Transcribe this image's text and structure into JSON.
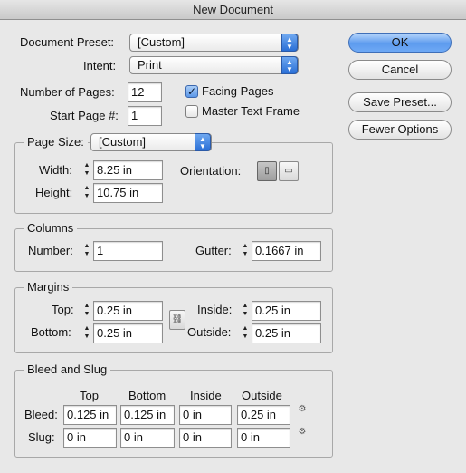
{
  "window": {
    "title": "New Document"
  },
  "document_preset": {
    "label": "Document Preset:",
    "value": "[Custom]"
  },
  "intent": {
    "label": "Intent:",
    "value": "Print"
  },
  "pages": {
    "number_label": "Number of Pages:",
    "number_value": "12",
    "start_label": "Start Page #:",
    "start_value": "1"
  },
  "options": {
    "facing_pages_label": "Facing Pages",
    "facing_pages_checked": true,
    "master_text_frame_label": "Master Text Frame",
    "master_text_frame_checked": false
  },
  "buttons": {
    "ok": "OK",
    "cancel": "Cancel",
    "save_preset": "Save Preset...",
    "fewer_options": "Fewer Options"
  },
  "page_size": {
    "label": "Page Size:",
    "value": "[Custom]",
    "width_label": "Width:",
    "width_value": "8.25 in",
    "height_label": "Height:",
    "height_value": "10.75 in",
    "orientation_label": "Orientation:",
    "orientation_selected": "portrait"
  },
  "columns": {
    "title": "Columns",
    "number_label": "Number:",
    "number_value": "1",
    "gutter_label": "Gutter:",
    "gutter_value": "0.1667 in"
  },
  "margins": {
    "title": "Margins",
    "top_label": "Top:",
    "top_value": "0.25 in",
    "bottom_label": "Bottom:",
    "bottom_value": "0.25 in",
    "inside_label": "Inside:",
    "inside_value": "0.25 in",
    "outside_label": "Outside:",
    "outside_value": "0.25 in"
  },
  "bleed_slug": {
    "title": "Bleed and Slug",
    "headers": [
      "Top",
      "Bottom",
      "Inside",
      "Outside"
    ],
    "bleed_label": "Bleed:",
    "bleed_values": [
      "0.125 in",
      "0.125 in",
      "0 in",
      "0.25 in"
    ],
    "slug_label": "Slug:",
    "slug_values": [
      "0 in",
      "0 in",
      "0 in",
      "0 in"
    ]
  },
  "colors": {
    "accent": "#4a8ee8",
    "background": "#e8e8e8"
  }
}
